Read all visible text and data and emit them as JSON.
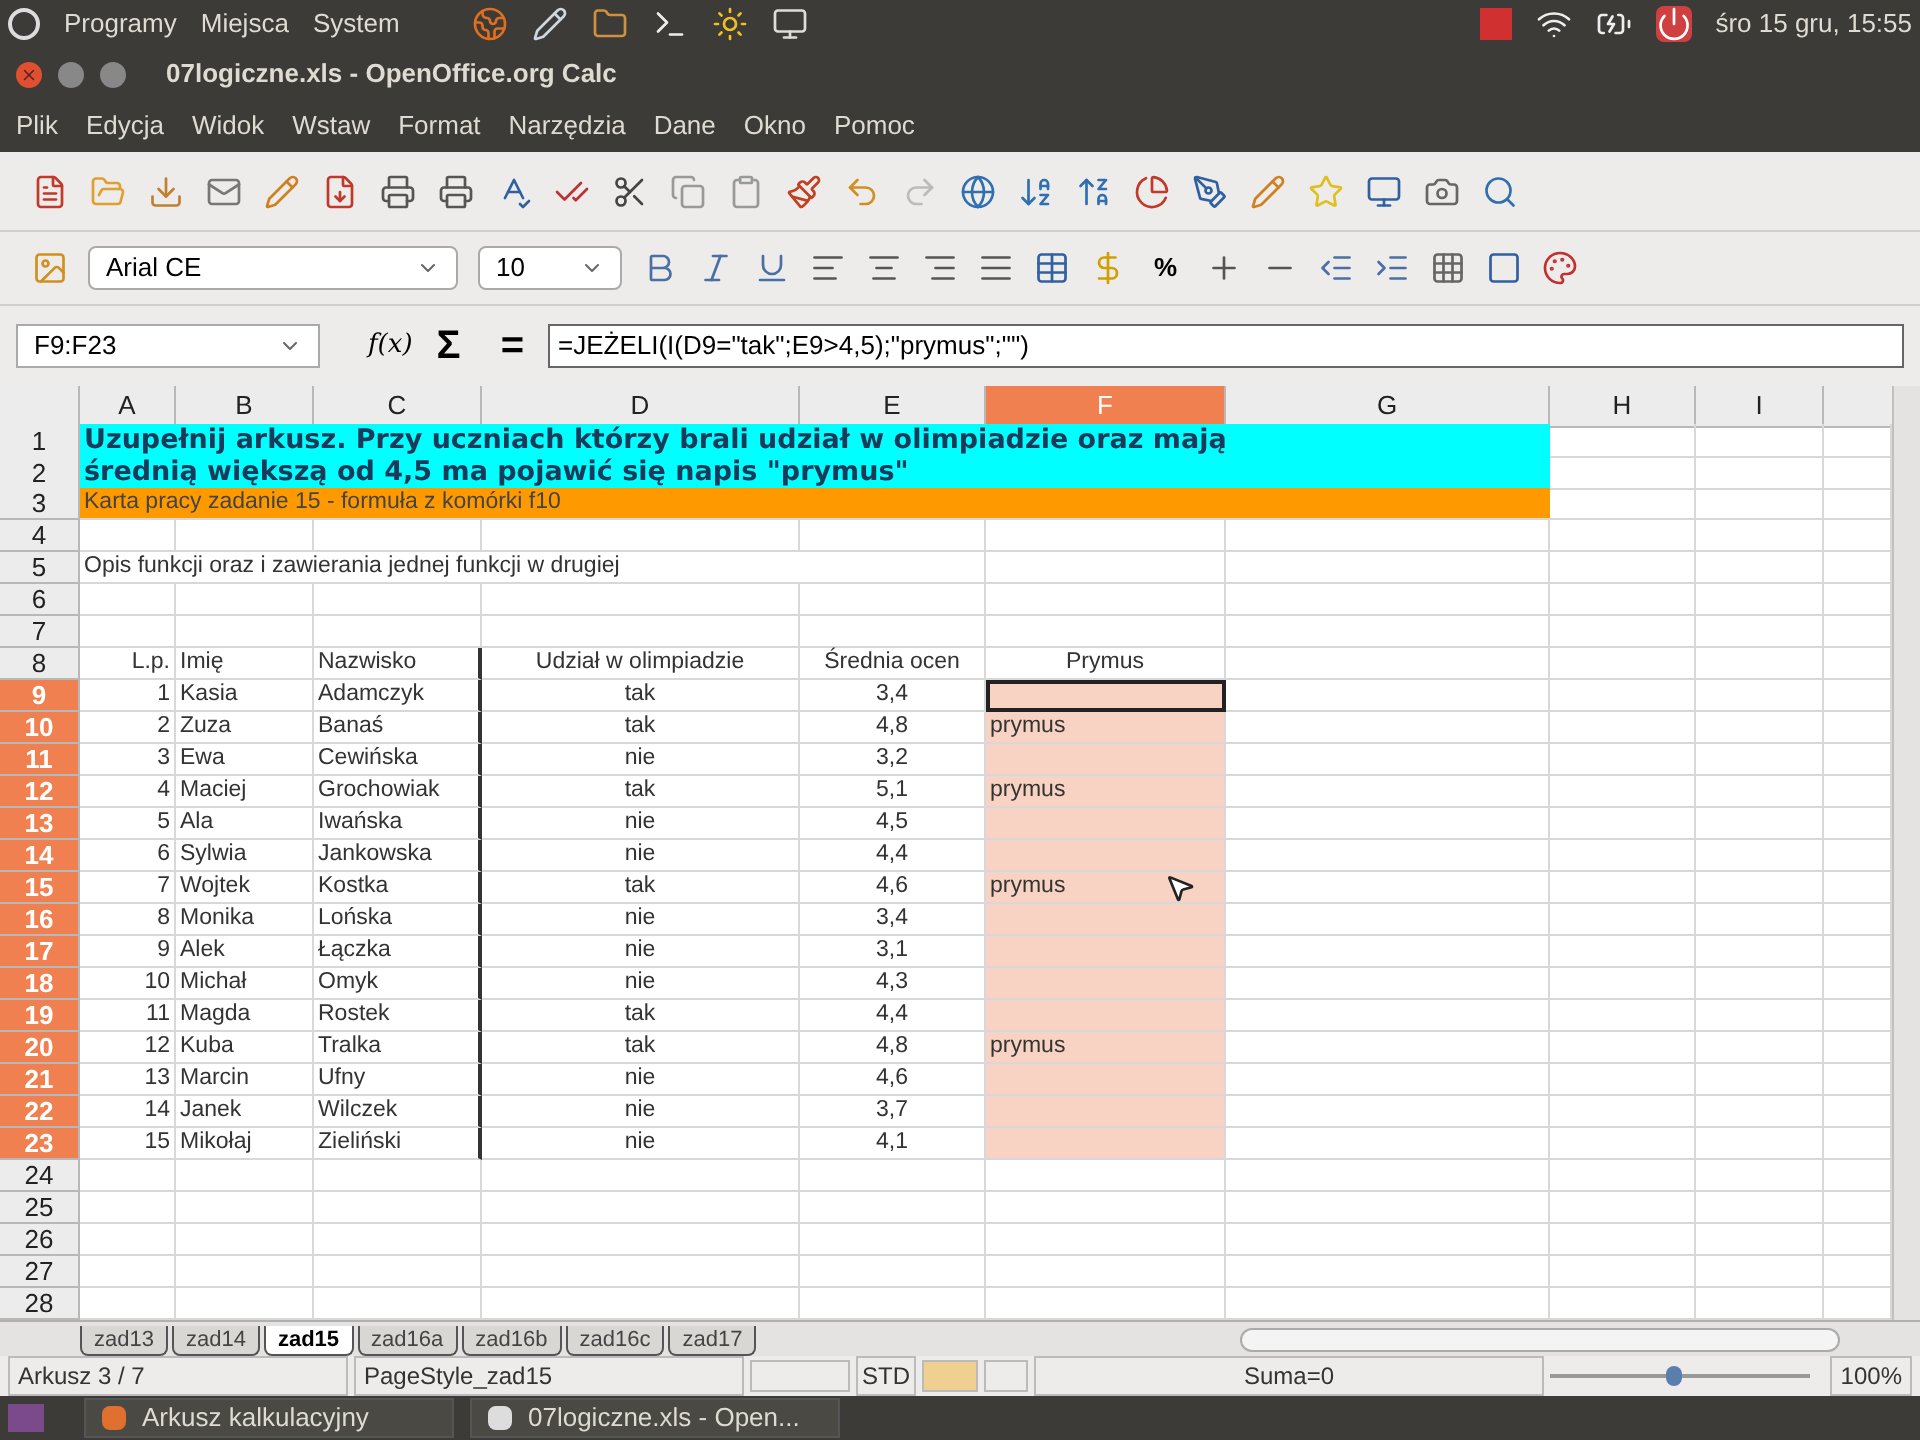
{
  "top_panel": {
    "menus": [
      "Programy",
      "Miejsca",
      "System"
    ],
    "clock": "śro 15 gru, 15:55"
  },
  "window": {
    "title": "07logiczne.xls - OpenOffice.org Calc"
  },
  "menu_bar": [
    "Plik",
    "Edycja",
    "Widok",
    "Wstaw",
    "Format",
    "Narzędzia",
    "Dane",
    "Okno",
    "Pomoc"
  ],
  "format_bar": {
    "font": "Arial CE",
    "size": "10",
    "percent": "%"
  },
  "formula_bar": {
    "name_box": "F9:F23",
    "function_wizard": "f(x)",
    "sum": "Σ",
    "equals": "=",
    "formula": "=JEŻELI(I(D9=\"tak\";E9>4,5);\"prymus\";\"\")"
  },
  "sheet": {
    "column_headers": [
      {
        "label": "A",
        "selected": false
      },
      {
        "label": "B",
        "selected": false
      },
      {
        "label": "C",
        "selected": false
      },
      {
        "label": "D",
        "selected": false
      },
      {
        "label": "E",
        "selected": false
      },
      {
        "label": "F",
        "selected": true
      },
      {
        "label": "G",
        "selected": false
      },
      {
        "label": "H",
        "selected": false
      },
      {
        "label": "I",
        "selected": false
      }
    ],
    "rows": [
      {
        "number": "1",
        "selected": false,
        "kind": "banner",
        "text": "Uzupełnij arkusz. Przy uczniach którzy brali udział w olimpiadzie oraz mają",
        "color": "#00ffff"
      },
      {
        "number": "2",
        "selected": false,
        "kind": "banner",
        "text": "średnią większą od 4,5 ma pojawić się napis \"prymus\"",
        "color": "#00ffff"
      },
      {
        "number": "3",
        "selected": false,
        "kind": "note",
        "text": "Karta pracy zadanie 15 - formuła z komórki f10",
        "color": "#ff9900"
      },
      {
        "number": "4",
        "selected": false,
        "kind": "empty"
      },
      {
        "number": "5",
        "selected": false,
        "kind": "text",
        "text": "Opis funkcji oraz i zawierania jednej funkcji w drugiej"
      },
      {
        "number": "6",
        "selected": false,
        "kind": "empty"
      },
      {
        "number": "7",
        "selected": false,
        "kind": "empty"
      },
      {
        "number": "8",
        "selected": false,
        "kind": "header",
        "cells": [
          "L.p.",
          "Imię",
          "Nazwisko",
          "Udział w olimpiadzie",
          "Średnia ocen",
          "Prymus"
        ]
      },
      {
        "number": "9",
        "selected": true,
        "kind": "data",
        "cursor": true,
        "cells": [
          "1",
          "Kasia",
          "Adamczyk",
          "tak",
          "3,4"
        ]
      },
      {
        "number": "10",
        "selected": true,
        "kind": "data",
        "cursor": false,
        "cells": [
          "2",
          "Zuza",
          "Banaś",
          "tak",
          "4,8",
          "prymus"
        ]
      },
      {
        "number": "11",
        "selected": true,
        "kind": "data",
        "cursor": false,
        "cells": [
          "3",
          "Ewa",
          "Cewińska",
          "nie",
          "3,2"
        ]
      },
      {
        "number": "12",
        "selected": true,
        "kind": "data",
        "cursor": false,
        "cells": [
          "4",
          "Maciej",
          "Grochowiak",
          "tak",
          "5,1",
          "prymus"
        ]
      },
      {
        "number": "13",
        "selected": true,
        "kind": "data",
        "cursor": false,
        "cells": [
          "5",
          "Ala",
          "Iwańska",
          "nie",
          "4,5"
        ]
      },
      {
        "number": "14",
        "selected": true,
        "kind": "data",
        "cursor": false,
        "cells": [
          "6",
          "Sylwia",
          "Jankowska",
          "nie",
          "4,4"
        ]
      },
      {
        "number": "15",
        "selected": true,
        "kind": "data",
        "cursor": false,
        "cells": [
          "7",
          "Wojtek",
          "Kostka",
          "tak",
          "4,6",
          "prymus"
        ]
      },
      {
        "number": "16",
        "selected": true,
        "kind": "data",
        "cursor": false,
        "cells": [
          "8",
          "Monika",
          "Lońska",
          "nie",
          "3,4"
        ]
      },
      {
        "number": "17",
        "selected": true,
        "kind": "data",
        "cursor": false,
        "cells": [
          "9",
          "Alek",
          "Łączka",
          "nie",
          "3,1"
        ]
      },
      {
        "number": "18",
        "selected": true,
        "kind": "data",
        "cursor": false,
        "cells": [
          "10",
          "Michał",
          "Omyk",
          "nie",
          "4,3"
        ]
      },
      {
        "number": "19",
        "selected": true,
        "kind": "data",
        "cursor": false,
        "cells": [
          "11",
          "Magda",
          "Rostek",
          "tak",
          "4,4"
        ]
      },
      {
        "number": "20",
        "selected": true,
        "kind": "data",
        "cursor": false,
        "cells": [
          "12",
          "Kuba",
          "Tralka",
          "tak",
          "4,8",
          "prymus"
        ]
      },
      {
        "number": "21",
        "selected": true,
        "kind": "data",
        "cursor": false,
        "cells": [
          "13",
          "Marcin",
          "Ufny",
          "nie",
          "4,6"
        ]
      },
      {
        "number": "22",
        "selected": true,
        "kind": "data",
        "cursor": false,
        "cells": [
          "14",
          "Janek",
          "Wilczek",
          "nie",
          "3,7"
        ]
      },
      {
        "number": "23",
        "selected": true,
        "kind": "data",
        "cursor": false,
        "cells": [
          "15",
          "Mikołaj",
          "Zieliński",
          "nie",
          "4,1"
        ]
      },
      {
        "number": "24",
        "selected": false,
        "kind": "empty"
      },
      {
        "number": "25",
        "selected": false,
        "kind": "empty"
      },
      {
        "number": "26",
        "selected": false,
        "kind": "empty"
      },
      {
        "number": "27",
        "selected": false,
        "kind": "empty"
      },
      {
        "number": "28",
        "selected": false,
        "kind": "empty"
      }
    ]
  },
  "sheet_tabs": [
    {
      "label": "zad13",
      "selected": false
    },
    {
      "label": "zad14",
      "selected": false
    },
    {
      "label": "zad15",
      "selected": true
    },
    {
      "label": "zad16a",
      "selected": false
    },
    {
      "label": "zad16b",
      "selected": false
    },
    {
      "label": "zad16c",
      "selected": false
    },
    {
      "label": "zad17",
      "selected": false
    }
  ],
  "status_bar": {
    "sheet": "Arkusz 3 / 7",
    "page_style": "PageStyle_zad15",
    "mode": "STD",
    "sum": "Suma=0",
    "zoom": {
      "level": 0.48,
      "reading": "100%"
    }
  },
  "taskbar": [
    "Arkusz kalkulacyjny",
    "07logiczne.xls - Open..."
  ]
}
